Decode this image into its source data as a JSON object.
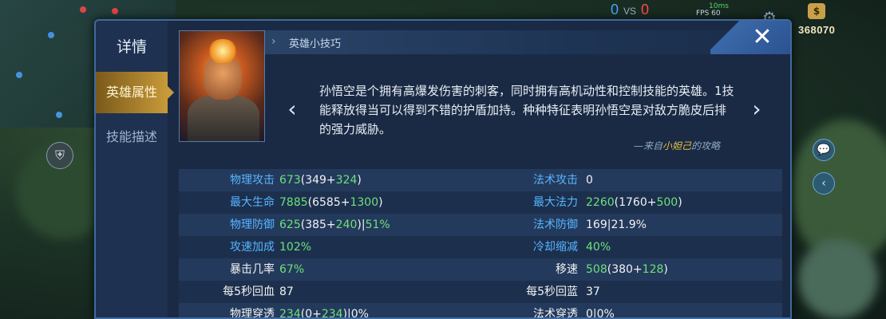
{
  "hud": {
    "score_blue": "0",
    "score_vs": "VS",
    "score_red": "0",
    "fps": "FPS 60",
    "ping": "10ms",
    "gold": "368070",
    "gold_symbol": "$"
  },
  "panel": {
    "sidebar_title": "详情",
    "tabs": [
      {
        "label": "英雄属性",
        "active": true
      },
      {
        "label": "技能描述",
        "active": false
      }
    ],
    "header_title": "英雄小技巧",
    "close_label": "✕",
    "tip_text": "孙悟空是个拥有高爆发伤害的刺客，同时拥有高机动性和控制技能的英雄。1技能释放得当可以得到不错的护盾加持。种种特征表明孙悟空是对敌方脆皮后排的强力威胁。",
    "tip_source_prefix": "—来自",
    "tip_source_author": "小妲己",
    "tip_source_suffix": "的攻略",
    "nav_prev": "‹",
    "nav_next": "›"
  },
  "stats": [
    {
      "left_label": "物理攻击",
      "left_label_color": "blue",
      "left_parts": [
        [
          "673",
          "green"
        ],
        [
          "(349+",
          "white"
        ],
        [
          "324",
          "green"
        ],
        [
          ")",
          "white"
        ]
      ],
      "right_label": "法术攻击",
      "right_label_color": "blue",
      "right_parts": [
        [
          "0",
          "white"
        ]
      ]
    },
    {
      "left_label": "最大生命",
      "left_label_color": "blue",
      "left_parts": [
        [
          "7885",
          "green"
        ],
        [
          "(6585+",
          "white"
        ],
        [
          "1300",
          "green"
        ],
        [
          ")",
          "white"
        ]
      ],
      "right_label": "最大法力",
      "right_label_color": "blue",
      "right_parts": [
        [
          "2260",
          "green"
        ],
        [
          "(1760+",
          "white"
        ],
        [
          "500",
          "green"
        ],
        [
          ")",
          "white"
        ]
      ]
    },
    {
      "left_label": "物理防御",
      "left_label_color": "blue",
      "left_parts": [
        [
          "625",
          "green"
        ],
        [
          "(385+",
          "white"
        ],
        [
          "240",
          "green"
        ],
        [
          ")|",
          "white"
        ],
        [
          "51%",
          "green"
        ]
      ],
      "right_label": "法术防御",
      "right_label_color": "blue",
      "right_parts": [
        [
          "169|21.9%",
          "white"
        ]
      ]
    },
    {
      "left_label": "攻速加成",
      "left_label_color": "blue",
      "left_parts": [
        [
          "102%",
          "green"
        ]
      ],
      "right_label": "冷却缩减",
      "right_label_color": "blue",
      "right_parts": [
        [
          "40%",
          "green"
        ]
      ]
    },
    {
      "left_label": "暴击几率",
      "left_label_color": "white",
      "left_parts": [
        [
          "67%",
          "green"
        ]
      ],
      "right_label": "移速",
      "right_label_color": "white",
      "right_parts": [
        [
          "508",
          "green"
        ],
        [
          "(380+",
          "white"
        ],
        [
          "128",
          "green"
        ],
        [
          ")",
          "white"
        ]
      ]
    },
    {
      "left_label": "每5秒回血",
      "left_label_color": "white",
      "left_parts": [
        [
          "87",
          "white"
        ]
      ],
      "right_label": "每5秒回蓝",
      "right_label_color": "white",
      "right_parts": [
        [
          "37",
          "white"
        ]
      ]
    },
    {
      "left_label": "物理穿透",
      "left_label_color": "white",
      "left_parts": [
        [
          "234",
          "green"
        ],
        [
          "(0+",
          "white"
        ],
        [
          "234",
          "green"
        ],
        [
          ")|0%",
          "white"
        ]
      ],
      "right_label": "法术穿透",
      "right_label_color": "white",
      "right_parts": [
        [
          "0|0%",
          "white"
        ]
      ]
    }
  ],
  "colors": {
    "blue": "#57b4ff",
    "green": "#6ee07a",
    "white": "#f2f2f2",
    "tab_active": "#c89a3a",
    "panel_bg": "#1a2a44"
  }
}
